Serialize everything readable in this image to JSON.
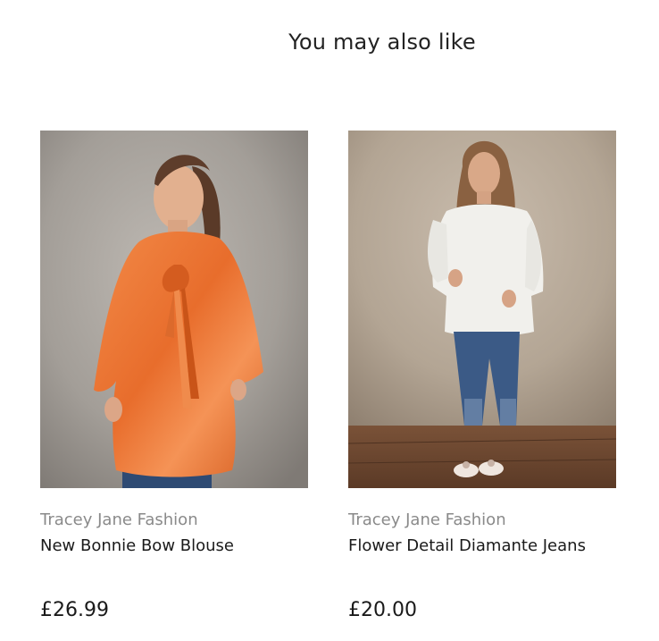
{
  "section": {
    "title": "You may also like"
  },
  "products": [
    {
      "vendor": "Tracey Jane Fashion",
      "title": "New Bonnie Bow Blouse",
      "price": "£26.99"
    },
    {
      "vendor": "Tracey Jane Fashion",
      "title": "Flower Detail Diamante Jeans",
      "price": "£20.00"
    }
  ],
  "colors": {
    "vendor_text": "#8a8a8a",
    "title_text": "#1a1a1a",
    "blouse_orange": "#ee7a3c",
    "backdrop_grey": "#a9a49e",
    "backdrop_beige": "#b8a999",
    "floor_wood": "#6e4a33"
  }
}
